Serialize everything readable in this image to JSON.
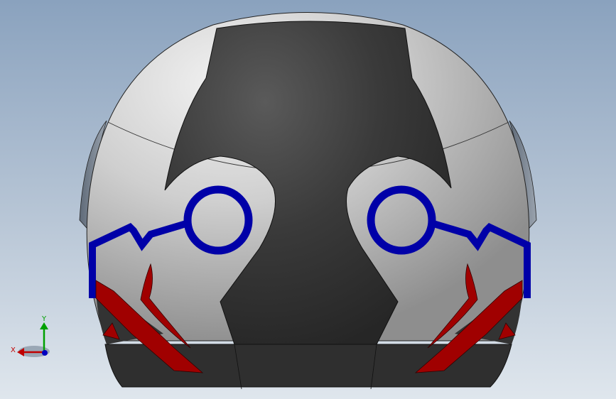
{
  "viewport": {
    "background_top": "#8aa2be",
    "background_bottom": "#dfe6ed"
  },
  "model": {
    "shell_color": "#c8c8c8",
    "dark_panel_color": "#333333",
    "blue_accent_color": "#0000a8",
    "red_accent_color": "#a00000"
  },
  "triad": {
    "x_label": "X",
    "y_label": "Y",
    "x_color": "#c00000",
    "y_color": "#00a000",
    "z_color": "#0000c0"
  }
}
